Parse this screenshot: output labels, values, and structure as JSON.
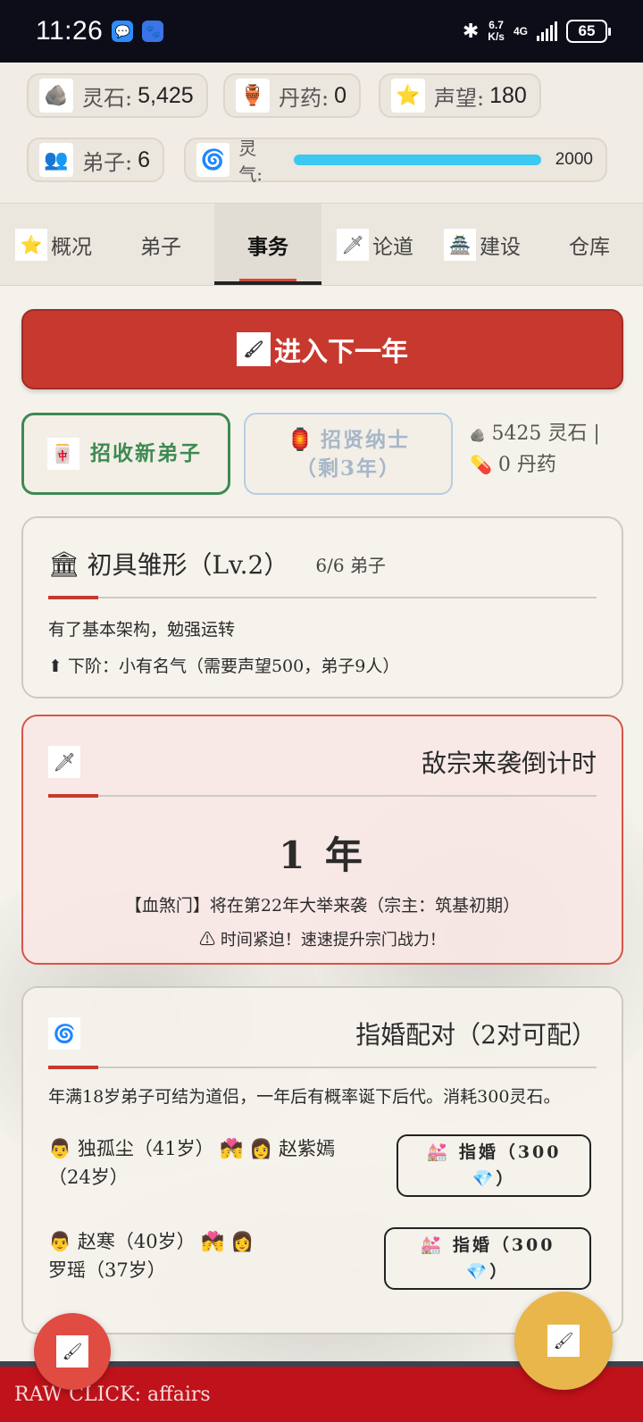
{
  "status_bar": {
    "time": "11:26",
    "net_speed_top": "6.7",
    "net_speed_bottom": "K/s",
    "network": "4G",
    "battery": "65"
  },
  "resources": {
    "spirit_stones": {
      "label": "灵石:",
      "value": "5,425",
      "icon": "rock-icon"
    },
    "pills": {
      "label": "丹药:",
      "value": "0",
      "icon": "gourd-icon"
    },
    "prestige": {
      "label": "声望:",
      "value": "180",
      "icon": "star-icon"
    },
    "disciples": {
      "label": "弟子:",
      "value": "6",
      "icon": "group-icon"
    },
    "qi": {
      "label": "灵气:",
      "value": "2000",
      "icon": "swirl-icon",
      "fill_fraction": 1.0
    }
  },
  "tabs": [
    {
      "label": "概况",
      "icon": "star-icon"
    },
    {
      "label": "弟子",
      "icon": ""
    },
    {
      "label": "事务",
      "icon": "",
      "active": true
    },
    {
      "label": "论道",
      "icon": "sword-icon"
    },
    {
      "label": "建设",
      "icon": "pagoda-icon"
    },
    {
      "label": "仓库",
      "icon": ""
    }
  ],
  "actions": {
    "next_year": "进入下一年",
    "recruit": "招收新弟子",
    "talent_line1": "招贤纳士",
    "talent_line2": "（剩3年）",
    "stock_line1": "5425 灵石 |",
    "stock_line2": "0 丹药"
  },
  "level": {
    "title": "初具雏形（Lv.2）",
    "count": "6/6 弟子",
    "desc": "有了基本架构，勉强运转",
    "next": "下阶：小有名气（需要声望500，弟子9人）"
  },
  "enemy": {
    "title": "敌宗来袭倒计时",
    "years": "1 年",
    "desc": "【血煞门】将在第22年大举来袭（宗主：筑基初期）",
    "warning": "⚠ 时间紧迫！速速提升宗门战力！"
  },
  "matchmaking": {
    "title": "指婚配对（2对可配）",
    "desc": "年满18岁弟子可结为道侣，一年后有概率诞下后代。消耗300灵石。",
    "pairs": [
      {
        "male": "独孤尘（41岁）",
        "female": "赵紫嫣（24岁）",
        "button_line1": "指婚（300",
        "button_line2": "）"
      },
      {
        "male": "赵寒（40岁）",
        "female": "罗瑶（37岁）",
        "button_line1": "指婚（300",
        "button_line2": "）"
      }
    ]
  },
  "debug": {
    "text": "RAW CLICK: affairs"
  },
  "colors": {
    "primary_red": "#c7392f",
    "green": "#3c8a52",
    "qi_blue": "#3cc8f0",
    "fab_gold": "#e8b64a"
  }
}
